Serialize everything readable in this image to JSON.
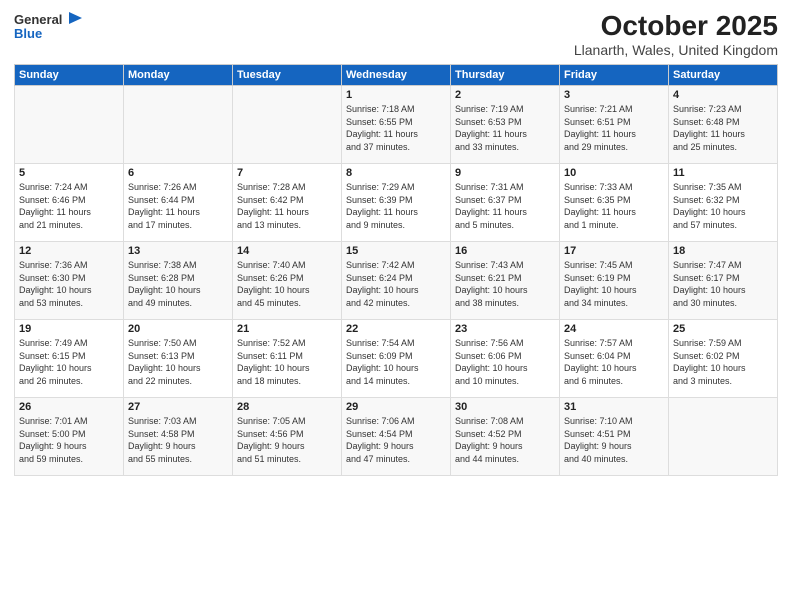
{
  "logo": {
    "general": "General",
    "blue": "Blue"
  },
  "title": "October 2025",
  "subtitle": "Llanarth, Wales, United Kingdom",
  "weekdays": [
    "Sunday",
    "Monday",
    "Tuesday",
    "Wednesday",
    "Thursday",
    "Friday",
    "Saturday"
  ],
  "weeks": [
    [
      {
        "day": "",
        "info": ""
      },
      {
        "day": "",
        "info": ""
      },
      {
        "day": "",
        "info": ""
      },
      {
        "day": "1",
        "info": "Sunrise: 7:18 AM\nSunset: 6:55 PM\nDaylight: 11 hours\nand 37 minutes."
      },
      {
        "day": "2",
        "info": "Sunrise: 7:19 AM\nSunset: 6:53 PM\nDaylight: 11 hours\nand 33 minutes."
      },
      {
        "day": "3",
        "info": "Sunrise: 7:21 AM\nSunset: 6:51 PM\nDaylight: 11 hours\nand 29 minutes."
      },
      {
        "day": "4",
        "info": "Sunrise: 7:23 AM\nSunset: 6:48 PM\nDaylight: 11 hours\nand 25 minutes."
      }
    ],
    [
      {
        "day": "5",
        "info": "Sunrise: 7:24 AM\nSunset: 6:46 PM\nDaylight: 11 hours\nand 21 minutes."
      },
      {
        "day": "6",
        "info": "Sunrise: 7:26 AM\nSunset: 6:44 PM\nDaylight: 11 hours\nand 17 minutes."
      },
      {
        "day": "7",
        "info": "Sunrise: 7:28 AM\nSunset: 6:42 PM\nDaylight: 11 hours\nand 13 minutes."
      },
      {
        "day": "8",
        "info": "Sunrise: 7:29 AM\nSunset: 6:39 PM\nDaylight: 11 hours\nand 9 minutes."
      },
      {
        "day": "9",
        "info": "Sunrise: 7:31 AM\nSunset: 6:37 PM\nDaylight: 11 hours\nand 5 minutes."
      },
      {
        "day": "10",
        "info": "Sunrise: 7:33 AM\nSunset: 6:35 PM\nDaylight: 11 hours\nand 1 minute."
      },
      {
        "day": "11",
        "info": "Sunrise: 7:35 AM\nSunset: 6:32 PM\nDaylight: 10 hours\nand 57 minutes."
      }
    ],
    [
      {
        "day": "12",
        "info": "Sunrise: 7:36 AM\nSunset: 6:30 PM\nDaylight: 10 hours\nand 53 minutes."
      },
      {
        "day": "13",
        "info": "Sunrise: 7:38 AM\nSunset: 6:28 PM\nDaylight: 10 hours\nand 49 minutes."
      },
      {
        "day": "14",
        "info": "Sunrise: 7:40 AM\nSunset: 6:26 PM\nDaylight: 10 hours\nand 45 minutes."
      },
      {
        "day": "15",
        "info": "Sunrise: 7:42 AM\nSunset: 6:24 PM\nDaylight: 10 hours\nand 42 minutes."
      },
      {
        "day": "16",
        "info": "Sunrise: 7:43 AM\nSunset: 6:21 PM\nDaylight: 10 hours\nand 38 minutes."
      },
      {
        "day": "17",
        "info": "Sunrise: 7:45 AM\nSunset: 6:19 PM\nDaylight: 10 hours\nand 34 minutes."
      },
      {
        "day": "18",
        "info": "Sunrise: 7:47 AM\nSunset: 6:17 PM\nDaylight: 10 hours\nand 30 minutes."
      }
    ],
    [
      {
        "day": "19",
        "info": "Sunrise: 7:49 AM\nSunset: 6:15 PM\nDaylight: 10 hours\nand 26 minutes."
      },
      {
        "day": "20",
        "info": "Sunrise: 7:50 AM\nSunset: 6:13 PM\nDaylight: 10 hours\nand 22 minutes."
      },
      {
        "day": "21",
        "info": "Sunrise: 7:52 AM\nSunset: 6:11 PM\nDaylight: 10 hours\nand 18 minutes."
      },
      {
        "day": "22",
        "info": "Sunrise: 7:54 AM\nSunset: 6:09 PM\nDaylight: 10 hours\nand 14 minutes."
      },
      {
        "day": "23",
        "info": "Sunrise: 7:56 AM\nSunset: 6:06 PM\nDaylight: 10 hours\nand 10 minutes."
      },
      {
        "day": "24",
        "info": "Sunrise: 7:57 AM\nSunset: 6:04 PM\nDaylight: 10 hours\nand 6 minutes."
      },
      {
        "day": "25",
        "info": "Sunrise: 7:59 AM\nSunset: 6:02 PM\nDaylight: 10 hours\nand 3 minutes."
      }
    ],
    [
      {
        "day": "26",
        "info": "Sunrise: 7:01 AM\nSunset: 5:00 PM\nDaylight: 9 hours\nand 59 minutes."
      },
      {
        "day": "27",
        "info": "Sunrise: 7:03 AM\nSunset: 4:58 PM\nDaylight: 9 hours\nand 55 minutes."
      },
      {
        "day": "28",
        "info": "Sunrise: 7:05 AM\nSunset: 4:56 PM\nDaylight: 9 hours\nand 51 minutes."
      },
      {
        "day": "29",
        "info": "Sunrise: 7:06 AM\nSunset: 4:54 PM\nDaylight: 9 hours\nand 47 minutes."
      },
      {
        "day": "30",
        "info": "Sunrise: 7:08 AM\nSunset: 4:52 PM\nDaylight: 9 hours\nand 44 minutes."
      },
      {
        "day": "31",
        "info": "Sunrise: 7:10 AM\nSunset: 4:51 PM\nDaylight: 9 hours\nand 40 minutes."
      },
      {
        "day": "",
        "info": ""
      }
    ]
  ]
}
